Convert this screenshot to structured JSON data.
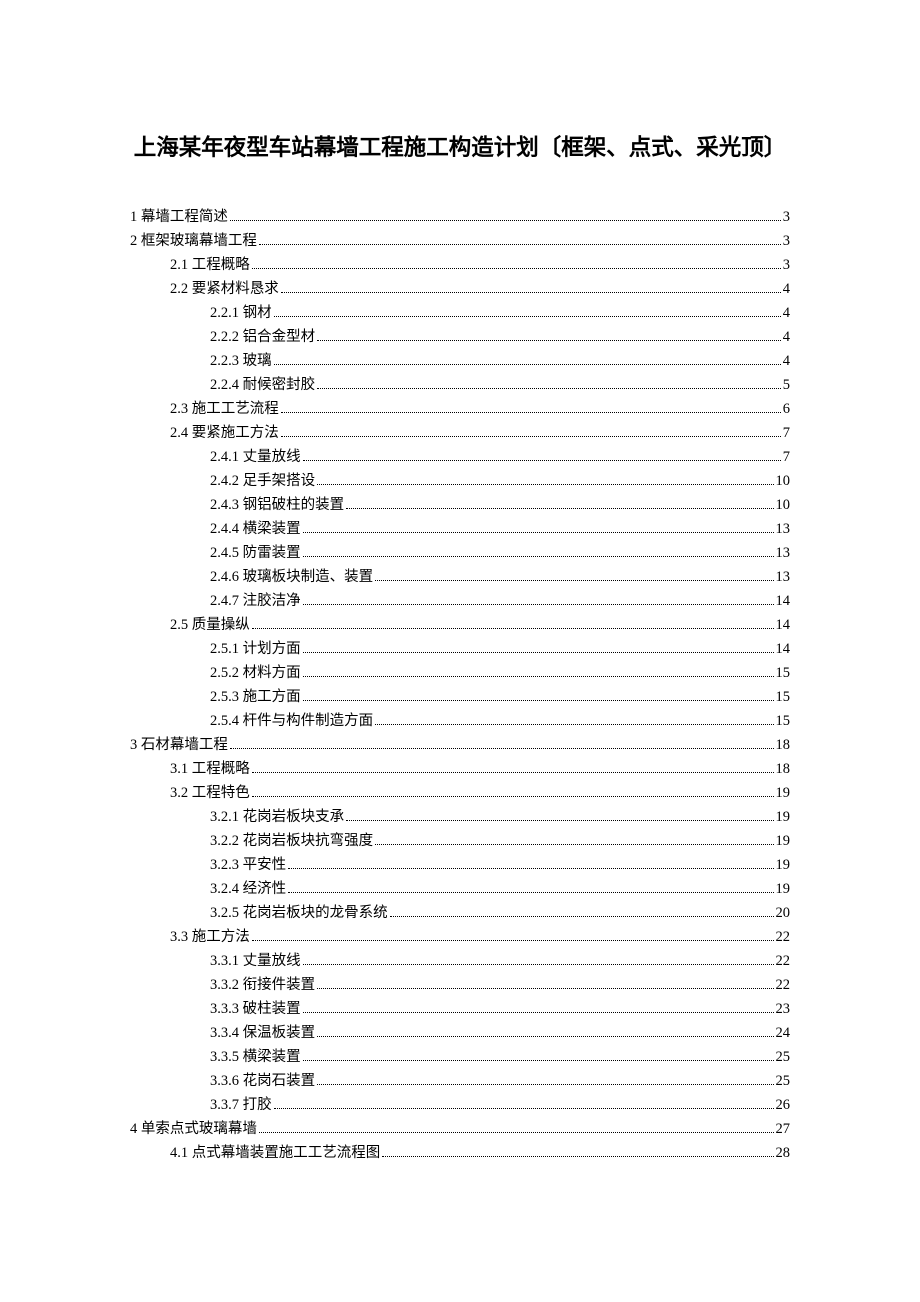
{
  "title": "上海某年夜型车站幕墙工程施工构造计划〔框架、点式、采光顶〕",
  "toc": [
    {
      "level": 0,
      "label": "1 幕墙工程简述",
      "page": "3"
    },
    {
      "level": 0,
      "label": "2 框架玻璃幕墙工程",
      "page": "3"
    },
    {
      "level": 1,
      "label": "2.1 工程概略",
      "page": "3"
    },
    {
      "level": 1,
      "label": "2.2 要紧材料恳求",
      "page": "4"
    },
    {
      "level": 2,
      "label": "2.2.1 钢材",
      "page": "4"
    },
    {
      "level": 2,
      "label": "2.2.2 铝合金型材",
      "page": "4"
    },
    {
      "level": 2,
      "label": "2.2.3 玻璃",
      "page": "4"
    },
    {
      "level": 2,
      "label": "2.2.4 耐候密封胶",
      "page": "5"
    },
    {
      "level": 1,
      "label": "2.3 施工工艺流程",
      "page": "6"
    },
    {
      "level": 1,
      "label": "2.4 要紧施工方法",
      "page": "7"
    },
    {
      "level": 2,
      "label": "2.4.1 丈量放线",
      "page": "7"
    },
    {
      "level": 2,
      "label": "2.4.2 足手架搭设",
      "page": "10"
    },
    {
      "level": 2,
      "label": "2.4.3 钢铝破柱的装置",
      "page": "10"
    },
    {
      "level": 2,
      "label": "2.4.4 横梁装置",
      "page": "13"
    },
    {
      "level": 2,
      "label": "2.4.5 防雷装置",
      "page": "13"
    },
    {
      "level": 2,
      "label": "2.4.6 玻璃板块制造、装置",
      "page": "13"
    },
    {
      "level": 2,
      "label": "2.4.7 注胶洁净",
      "page": "14"
    },
    {
      "level": 1,
      "label": "2.5 质量操纵",
      "page": "14"
    },
    {
      "level": 2,
      "label": "2.5.1 计划方面",
      "page": "14"
    },
    {
      "level": 2,
      "label": "2.5.2 材料方面",
      "page": "15"
    },
    {
      "level": 2,
      "label": "2.5.3 施工方面",
      "page": "15"
    },
    {
      "level": 2,
      "label": "2.5.4 杆件与构件制造方面",
      "page": "15"
    },
    {
      "level": 0,
      "label": "3 石材幕墙工程",
      "page": "18"
    },
    {
      "level": 1,
      "label": "3.1 工程概略",
      "page": "18"
    },
    {
      "level": 1,
      "label": "3.2 工程特色",
      "page": "19"
    },
    {
      "level": 2,
      "label": "3.2.1 花岗岩板块支承",
      "page": "19"
    },
    {
      "level": 2,
      "label": "3.2.2 花岗岩板块抗弯强度",
      "page": "19"
    },
    {
      "level": 2,
      "label": "3.2.3 平安性",
      "page": "19"
    },
    {
      "level": 2,
      "label": "3.2.4 经济性",
      "page": "19"
    },
    {
      "level": 2,
      "label": "3.2.5 花岗岩板块的龙骨系统",
      "page": "20"
    },
    {
      "level": 1,
      "label": "3.3 施工方法",
      "page": "22"
    },
    {
      "level": 2,
      "label": "3.3.1 丈量放线",
      "page": "22"
    },
    {
      "level": 2,
      "label": "3.3.2 衔接件装置",
      "page": "22"
    },
    {
      "level": 2,
      "label": "3.3.3 破柱装置",
      "page": "23"
    },
    {
      "level": 2,
      "label": "3.3.4 保温板装置",
      "page": "24"
    },
    {
      "level": 2,
      "label": "3.3.5 横梁装置",
      "page": "25"
    },
    {
      "level": 2,
      "label": "3.3.6 花岗石装置",
      "page": "25"
    },
    {
      "level": 2,
      "label": "3.3.7 打胶",
      "page": "26"
    },
    {
      "level": 0,
      "label": "4 单索点式玻璃幕墙",
      "page": "27"
    },
    {
      "level": 1,
      "label": "4.1 点式幕墙装置施工工艺流程图",
      "page": "28",
      "leaderStyle": "spaced"
    }
  ]
}
